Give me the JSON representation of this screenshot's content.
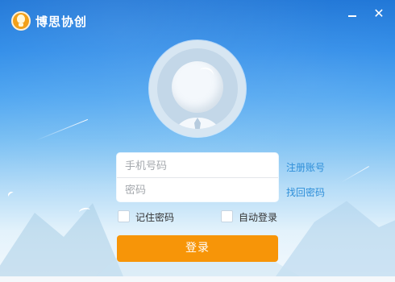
{
  "window": {
    "title": "博思协创",
    "minimize_symbol": "",
    "close_symbol": "✕"
  },
  "login": {
    "phone_placeholder": "手机号码",
    "password_placeholder": "密码",
    "register_link": "注册账号",
    "forgot_link": "找回密码",
    "remember_label": "记住密码",
    "autologin_label": "自动登录",
    "login_button": "登录"
  },
  "icons": {
    "logo": "lightbulb-logo-icon",
    "avatar": "default-user-avatar-icon",
    "minimize": "minimize-icon",
    "close": "close-icon"
  },
  "colors": {
    "accent_orange": "#f79508",
    "link_blue": "#2f8fd9",
    "sky_top": "#1a73d6"
  }
}
